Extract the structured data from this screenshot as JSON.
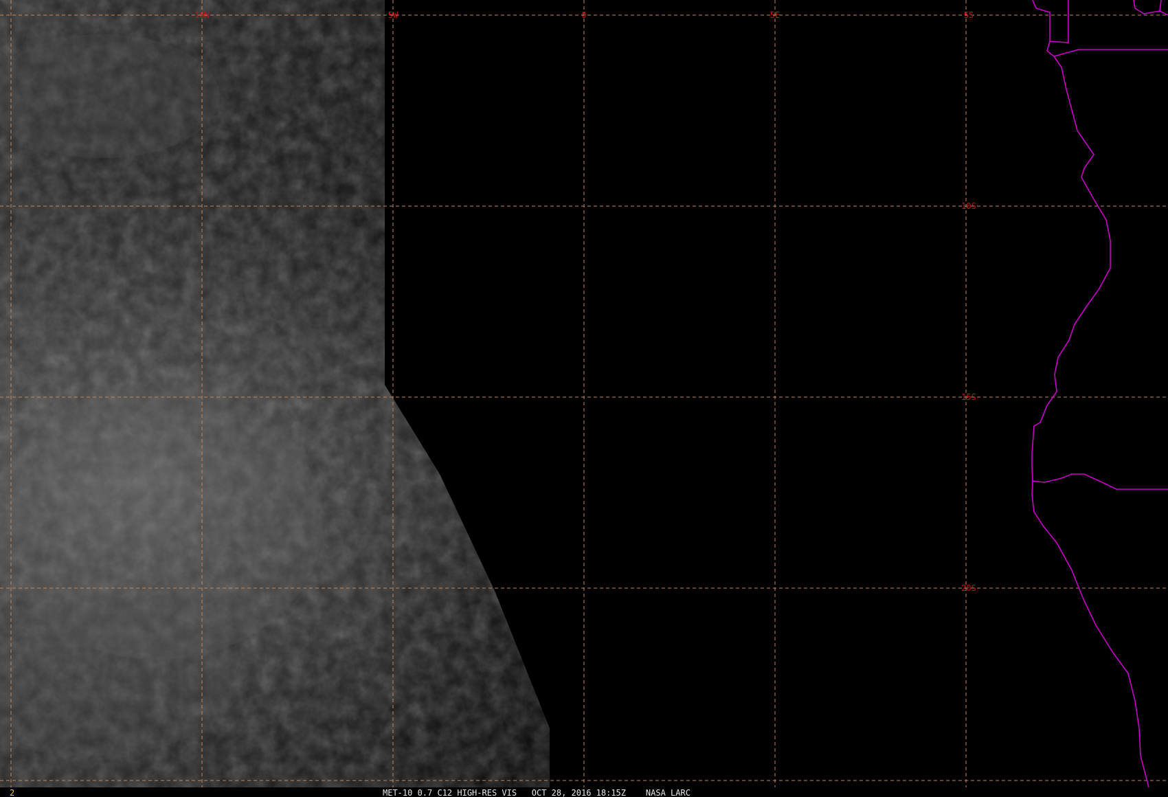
{
  "map": {
    "grid_labels": {
      "longitudes": [
        "10W",
        "5W",
        "0",
        "5E"
      ],
      "latitudes": [
        "5S",
        "10S",
        "15S",
        "20S"
      ]
    },
    "colors": {
      "background": "#000000",
      "grid": "#c8875a",
      "grid_labels": "#c81414",
      "coastline": "#c800c8",
      "caption": "#e6e6e6",
      "frame_number": "#e6d200"
    }
  },
  "status_bar": {
    "frame_number": "2",
    "caption": "MET-10 0.7 C12 HIGH-RES VIS   OCT 28, 2016 18:15Z    NASA LARC"
  }
}
